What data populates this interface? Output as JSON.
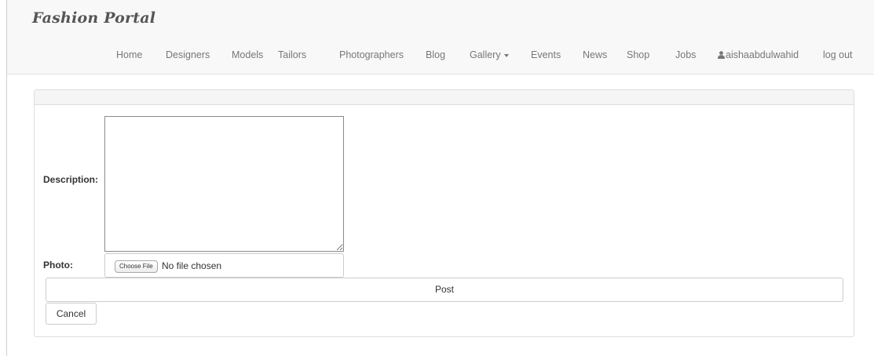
{
  "brand": "Fashion Portal",
  "nav": {
    "items": [
      {
        "label": "Home"
      },
      {
        "label": "Designers"
      },
      {
        "label": "Models"
      },
      {
        "label": "Tailors"
      },
      {
        "label": "Photographers"
      },
      {
        "label": "Blog"
      },
      {
        "label": "Gallery"
      },
      {
        "label": "Events"
      },
      {
        "label": "News"
      },
      {
        "label": "Shop"
      },
      {
        "label": "Jobs"
      },
      {
        "label": "aishaabdulwahid",
        "icon": "user-icon"
      },
      {
        "label": "log out"
      }
    ],
    "dropdown_icon": "caret-down-icon"
  },
  "form": {
    "description_label": "Description:",
    "description_value": "",
    "photo_label": "Photo:",
    "choose_file_label": "Choose File",
    "file_status": "No file chosen",
    "post_label": "Post",
    "cancel_label": "Cancel"
  },
  "colors": {
    "navbar_bg": "#f8f8f8",
    "nav_text": "#777777",
    "border": "#dddddd"
  }
}
